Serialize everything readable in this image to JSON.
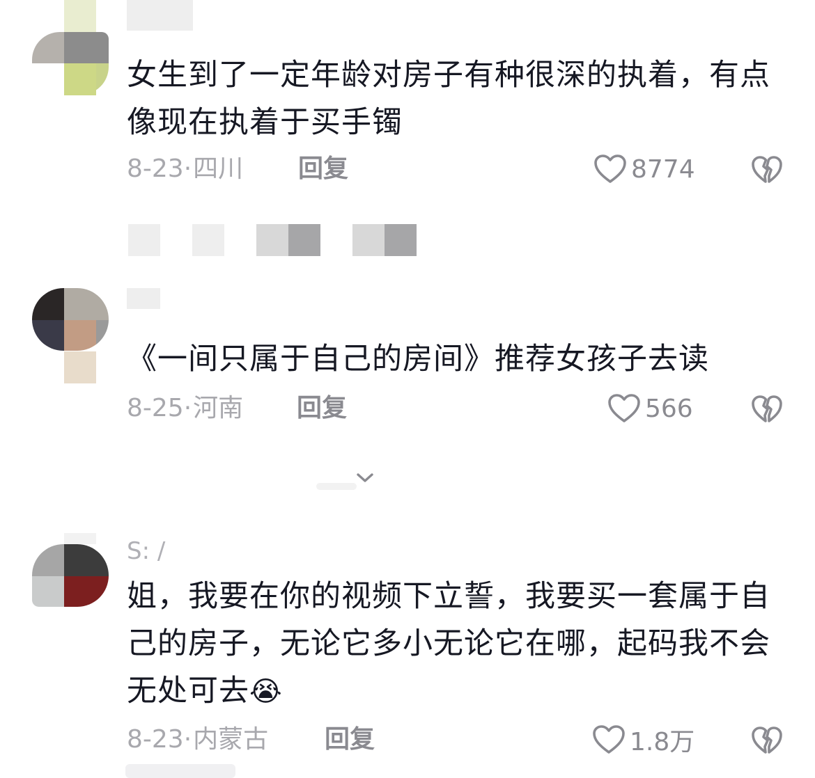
{
  "comments": [
    {
      "username": "",
      "text": "女生到了一定年龄对房子有种很深的执着，有点像现在执着于买手镯",
      "date": "8-23",
      "location": "四川",
      "reply_label": "回复",
      "likes": "8774"
    },
    {
      "username": "",
      "text": "《一间只属于自己的房间》推荐女孩子去读",
      "date": "8-25",
      "location": "河南",
      "reply_label": "回复",
      "likes": "566"
    },
    {
      "username": "S: /",
      "text": "姐，我要在你的视频下立誓，我要买一套属于自己的房子，无论它多小无论它在哪，起码我不会无处可去",
      "emoji": "😭",
      "date": "8-23",
      "location": "内蒙古",
      "reply_label": "回复",
      "likes": "1.8万"
    }
  ],
  "colors": {
    "text": "#161823",
    "muted": "#a8a8ad",
    "action": "#8a8a90"
  },
  "icons": [
    "heart-icon",
    "broken-heart-dislike-icon",
    "chevron-down-icon",
    "crying-face-emoji"
  ]
}
